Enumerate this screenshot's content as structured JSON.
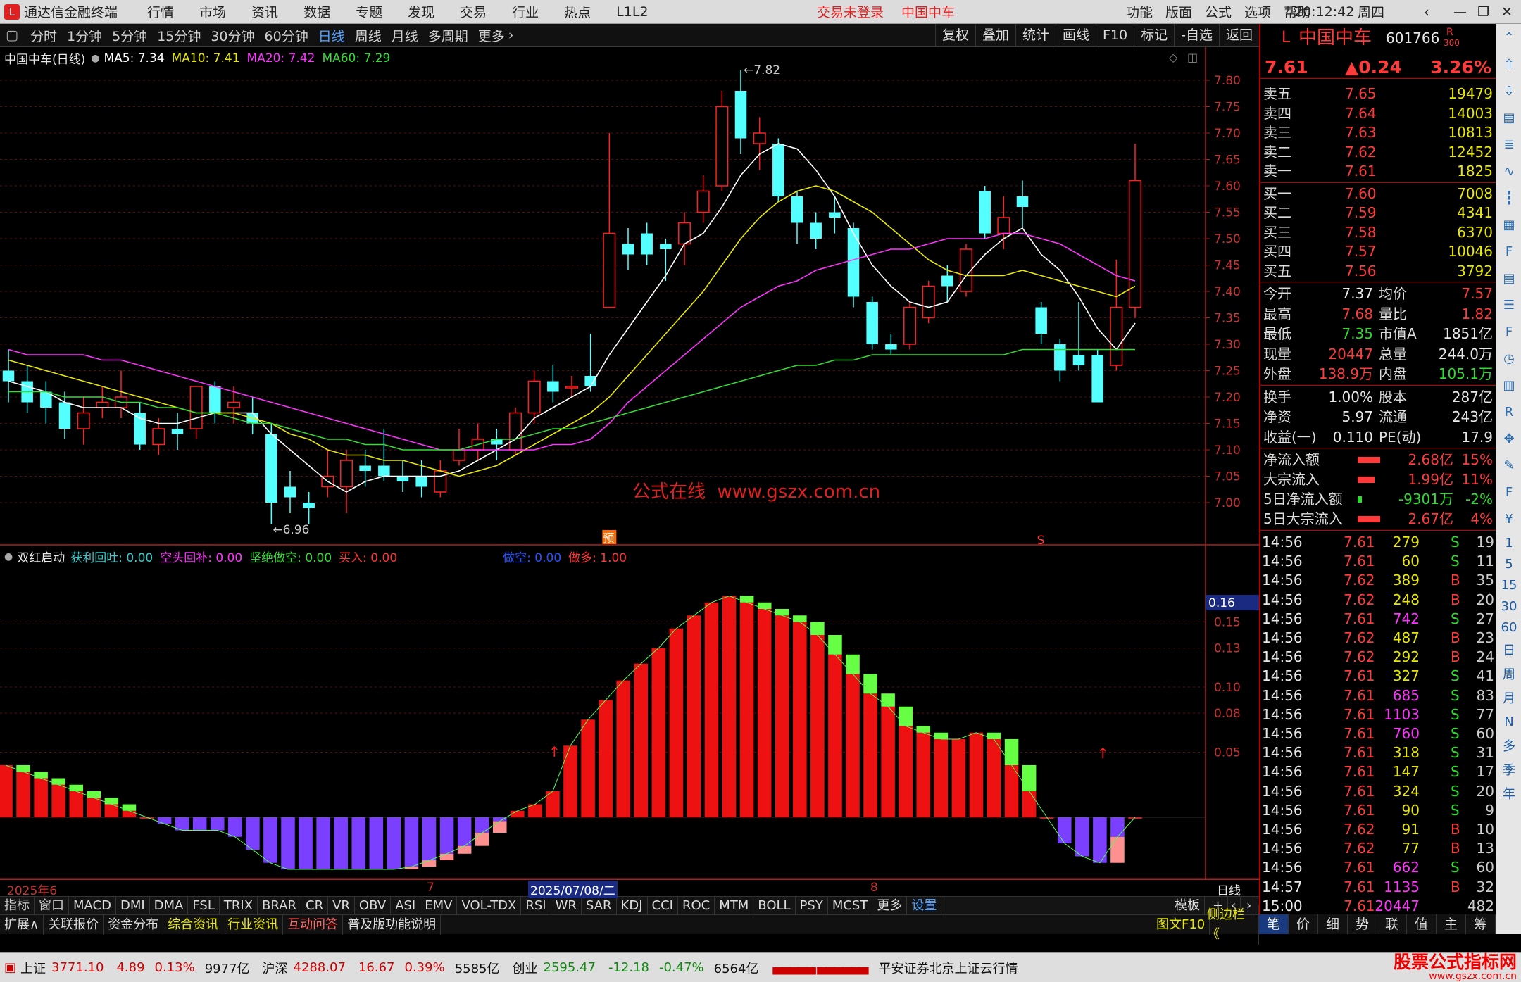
{
  "titlebar": {
    "app_name": "通达信金融终端",
    "menus": [
      "行情",
      "市场",
      "资讯",
      "数据",
      "专题",
      "发现",
      "交易",
      "行业",
      "热点",
      "L1L2"
    ],
    "trade_status": "交易未登录",
    "stock_name": "中国中车",
    "right_menus": [
      "功能",
      "版面",
      "公式",
      "选项",
      "帮助"
    ],
    "time": "20:12:42",
    "weekday": "周四"
  },
  "periodbar": {
    "periods": [
      "分时",
      "1分钟",
      "5分钟",
      "15分钟",
      "30分钟",
      "60分钟",
      "日线",
      "周线",
      "月线",
      "多周期",
      "更多"
    ],
    "active_index": 6,
    "tools": [
      "复权",
      "叠加",
      "统计",
      "画线",
      "F10",
      "标记",
      "-自选",
      "返回"
    ]
  },
  "main_chart": {
    "title": "中国中车(日线)",
    "ma_labels": [
      {
        "text": "MA5: 7.34",
        "color": "#ffffff"
      },
      {
        "text": "MA10: 7.41",
        "color": "#e8e800"
      },
      {
        "text": "MA20: 7.42",
        "color": "#ff33ff"
      },
      {
        "text": "MA60: 7.29",
        "color": "#33dd33"
      }
    ],
    "price_ticks": [
      "7.80",
      "7.75",
      "7.70",
      "7.65",
      "7.60",
      "7.55",
      "7.50",
      "7.45",
      "7.40",
      "7.35",
      "7.30",
      "7.25",
      "7.20",
      "7.15",
      "7.10",
      "7.05",
      "7.00"
    ],
    "high_label": "7.82",
    "low_label": "6.96",
    "watermark": "公式在线  www.gszx.com.cn",
    "marker_yu": "预",
    "marker_s": "S",
    "candles": [
      {
        "o": 7.25,
        "c": 7.23,
        "h": 7.29,
        "l": 7.19
      },
      {
        "o": 7.23,
        "c": 7.19,
        "h": 7.26,
        "l": 7.17
      },
      {
        "o": 7.21,
        "c": 7.18,
        "h": 7.23,
        "l": 7.15
      },
      {
        "o": 7.19,
        "c": 7.14,
        "h": 7.21,
        "l": 7.12
      },
      {
        "o": 7.14,
        "c": 7.17,
        "h": 7.2,
        "l": 7.11
      },
      {
        "o": 7.18,
        "c": 7.19,
        "h": 7.22,
        "l": 7.16
      },
      {
        "o": 7.18,
        "c": 7.2,
        "h": 7.25,
        "l": 7.16
      },
      {
        "o": 7.17,
        "c": 7.11,
        "h": 7.19,
        "l": 7.1
      },
      {
        "o": 7.11,
        "c": 7.14,
        "h": 7.16,
        "l": 7.09
      },
      {
        "o": 7.14,
        "c": 7.13,
        "h": 7.17,
        "l": 7.1
      },
      {
        "o": 7.14,
        "c": 7.22,
        "h": 7.22,
        "l": 7.12
      },
      {
        "o": 7.22,
        "c": 7.17,
        "h": 7.23,
        "l": 7.15
      },
      {
        "o": 7.18,
        "c": 7.19,
        "h": 7.22,
        "l": 7.15
      },
      {
        "o": 7.17,
        "c": 7.15,
        "h": 7.2,
        "l": 7.13
      },
      {
        "o": 7.13,
        "c": 7.0,
        "h": 7.15,
        "l": 6.96
      },
      {
        "o": 7.03,
        "c": 7.01,
        "h": 7.06,
        "l": 6.98
      },
      {
        "o": 7.0,
        "c": 6.99,
        "h": 7.02,
        "l": 6.96
      },
      {
        "o": 7.03,
        "c": 7.05,
        "h": 7.1,
        "l": 7.01
      },
      {
        "o": 7.03,
        "c": 7.08,
        "h": 7.1,
        "l": 6.98
      },
      {
        "o": 7.07,
        "c": 7.06,
        "h": 7.1,
        "l": 7.03
      },
      {
        "o": 7.07,
        "c": 7.05,
        "h": 7.14,
        "l": 7.04
      },
      {
        "o": 7.05,
        "c": 7.04,
        "h": 7.08,
        "l": 7.02
      },
      {
        "o": 7.05,
        "c": 7.03,
        "h": 7.08,
        "l": 7.01
      },
      {
        "o": 7.02,
        "c": 7.06,
        "h": 7.08,
        "l": 7.01
      },
      {
        "o": 7.08,
        "c": 7.1,
        "h": 7.14,
        "l": 7.07
      },
      {
        "o": 7.1,
        "c": 7.12,
        "h": 7.15,
        "l": 7.08
      },
      {
        "o": 7.12,
        "c": 7.11,
        "h": 7.14,
        "l": 7.08
      },
      {
        "o": 7.1,
        "c": 7.17,
        "h": 7.18,
        "l": 7.09
      },
      {
        "o": 7.17,
        "c": 7.23,
        "h": 7.25,
        "l": 7.15
      },
      {
        "o": 7.23,
        "c": 7.21,
        "h": 7.26,
        "l": 7.19
      },
      {
        "o": 7.22,
        "c": 7.22,
        "h": 7.24,
        "l": 7.2
      },
      {
        "o": 7.24,
        "c": 7.22,
        "h": 7.32,
        "l": 7.21
      },
      {
        "o": 7.37,
        "c": 7.51,
        "h": 7.7,
        "l": 7.37
      },
      {
        "o": 7.49,
        "c": 7.47,
        "h": 7.52,
        "l": 7.44
      },
      {
        "o": 7.51,
        "c": 7.47,
        "h": 7.53,
        "l": 7.45
      },
      {
        "o": 7.49,
        "c": 7.48,
        "h": 7.5,
        "l": 7.42
      },
      {
        "o": 7.49,
        "c": 7.53,
        "h": 7.55,
        "l": 7.45
      },
      {
        "o": 7.55,
        "c": 7.59,
        "h": 7.62,
        "l": 7.53
      },
      {
        "o": 7.6,
        "c": 7.75,
        "h": 7.78,
        "l": 7.59
      },
      {
        "o": 7.78,
        "c": 7.69,
        "h": 7.82,
        "l": 7.66
      },
      {
        "o": 7.68,
        "c": 7.7,
        "h": 7.73,
        "l": 7.63
      },
      {
        "o": 7.68,
        "c": 7.58,
        "h": 7.69,
        "l": 7.57
      },
      {
        "o": 7.58,
        "c": 7.53,
        "h": 7.59,
        "l": 7.49
      },
      {
        "o": 7.53,
        "c": 7.5,
        "h": 7.55,
        "l": 7.48
      },
      {
        "o": 7.55,
        "c": 7.54,
        "h": 7.58,
        "l": 7.51
      },
      {
        "o": 7.52,
        "c": 7.39,
        "h": 7.53,
        "l": 7.37
      },
      {
        "o": 7.38,
        "c": 7.3,
        "h": 7.39,
        "l": 7.29
      },
      {
        "o": 7.3,
        "c": 7.29,
        "h": 7.32,
        "l": 7.28
      },
      {
        "o": 7.3,
        "c": 7.37,
        "h": 7.38,
        "l": 7.29
      },
      {
        "o": 7.35,
        "c": 7.41,
        "h": 7.42,
        "l": 7.34
      },
      {
        "o": 7.43,
        "c": 7.41,
        "h": 7.45,
        "l": 7.38
      },
      {
        "o": 7.4,
        "c": 7.48,
        "h": 7.49,
        "l": 7.39
      },
      {
        "o": 7.59,
        "c": 7.51,
        "h": 7.6,
        "l": 7.5
      },
      {
        "o": 7.51,
        "c": 7.54,
        "h": 7.58,
        "l": 7.48
      },
      {
        "o": 7.58,
        "c": 7.56,
        "h": 7.61,
        "l": 7.52
      },
      {
        "o": 7.37,
        "c": 7.32,
        "h": 7.38,
        "l": 7.3
      },
      {
        "o": 7.3,
        "c": 7.25,
        "h": 7.31,
        "l": 7.23
      },
      {
        "o": 7.28,
        "c": 7.26,
        "h": 7.38,
        "l": 7.25
      },
      {
        "o": 7.28,
        "c": 7.19,
        "h": 7.29,
        "l": 7.19
      },
      {
        "o": 7.26,
        "c": 7.37,
        "h": 7.46,
        "l": 7.25
      },
      {
        "o": 7.37,
        "c": 7.61,
        "h": 7.68,
        "l": 7.35
      }
    ],
    "ma5": [
      7.23,
      7.22,
      7.21,
      7.19,
      7.18,
      7.18,
      7.18,
      7.16,
      7.15,
      7.15,
      7.16,
      7.17,
      7.17,
      7.17,
      7.13,
      7.1,
      7.07,
      7.04,
      7.02,
      7.04,
      7.05,
      7.05,
      7.05,
      7.05,
      7.06,
      7.08,
      7.1,
      7.12,
      7.16,
      7.18,
      7.2,
      7.22,
      7.28,
      7.33,
      7.38,
      7.43,
      7.49,
      7.51,
      7.56,
      7.62,
      7.66,
      7.68,
      7.67,
      7.63,
      7.58,
      7.51,
      7.45,
      7.41,
      7.38,
      7.37,
      7.38,
      7.43,
      7.47,
      7.5,
      7.52,
      7.47,
      7.44,
      7.39,
      7.33,
      7.29,
      7.34
    ],
    "ma10": [
      7.27,
      7.26,
      7.25,
      7.24,
      7.23,
      7.22,
      7.21,
      7.2,
      7.19,
      7.18,
      7.17,
      7.17,
      7.17,
      7.16,
      7.15,
      7.13,
      7.12,
      7.1,
      7.09,
      7.09,
      7.08,
      7.08,
      7.07,
      7.06,
      7.05,
      7.06,
      7.07,
      7.09,
      7.11,
      7.13,
      7.15,
      7.17,
      7.2,
      7.24,
      7.28,
      7.32,
      7.36,
      7.4,
      7.45,
      7.5,
      7.54,
      7.57,
      7.59,
      7.6,
      7.59,
      7.57,
      7.55,
      7.52,
      7.49,
      7.46,
      7.44,
      7.43,
      7.43,
      7.43,
      7.44,
      7.43,
      7.42,
      7.41,
      7.4,
      7.39,
      7.41
    ],
    "ma20": [
      7.29,
      7.28,
      7.28,
      7.28,
      7.28,
      7.27,
      7.27,
      7.26,
      7.25,
      7.24,
      7.23,
      7.22,
      7.21,
      7.2,
      7.19,
      7.18,
      7.17,
      7.16,
      7.15,
      7.14,
      7.13,
      7.12,
      7.11,
      7.1,
      7.1,
      7.1,
      7.1,
      7.1,
      7.1,
      7.11,
      7.11,
      7.12,
      7.15,
      7.19,
      7.22,
      7.25,
      7.28,
      7.31,
      7.34,
      7.37,
      7.39,
      7.41,
      7.42,
      7.44,
      7.45,
      7.46,
      7.47,
      7.48,
      7.48,
      7.49,
      7.5,
      7.5,
      7.5,
      7.51,
      7.51,
      7.5,
      7.49,
      7.47,
      7.45,
      7.43,
      7.42
    ],
    "ma60": [
      7.21,
      7.21,
      7.21,
      7.2,
      7.2,
      7.2,
      7.19,
      7.19,
      7.18,
      7.18,
      7.17,
      7.17,
      7.16,
      7.15,
      7.15,
      7.14,
      7.13,
      7.12,
      7.12,
      7.11,
      7.11,
      7.1,
      7.1,
      7.1,
      7.1,
      7.11,
      7.12,
      7.12,
      7.13,
      7.14,
      7.14,
      7.15,
      7.16,
      7.17,
      7.18,
      7.19,
      7.2,
      7.21,
      7.22,
      7.23,
      7.24,
      7.25,
      7.26,
      7.26,
      7.27,
      7.27,
      7.28,
      7.28,
      7.28,
      7.28,
      7.28,
      7.28,
      7.28,
      7.28,
      7.29,
      7.29,
      7.29,
      7.29,
      7.29,
      7.29,
      7.29
    ]
  },
  "indicator": {
    "name": "双红启动",
    "params": [
      {
        "text": "获利回吐: 0.00",
        "color": "#33cccc"
      },
      {
        "text": "空头回补: 0.00",
        "color": "#ff33ff"
      },
      {
        "text": "坚绝做空: 0.00",
        "color": "#33dd33"
      },
      {
        "text": "买入: 0.00",
        "color": "#ff3333"
      },
      {
        "text": "做空: 0.00",
        "color": "#2255ff"
      },
      {
        "text": "做多: 1.00",
        "color": "#ff3333"
      }
    ],
    "ticks": [
      "0.15",
      "0.13",
      "0.10",
      "0.08",
      "0.05"
    ],
    "current_value": "0.16",
    "values": [
      0.04,
      0.035,
      0.03,
      0.025,
      0.02,
      0.015,
      0.01,
      0.005,
      0.0,
      -0.005,
      -0.01,
      -0.01,
      -0.01,
      -0.015,
      -0.025,
      -0.035,
      -0.04,
      -0.04,
      -0.04,
      -0.04,
      -0.04,
      -0.04,
      -0.04,
      -0.038,
      -0.033,
      -0.028,
      -0.022,
      -0.012,
      -0.003,
      0.005,
      0.01,
      0.02,
      0.055,
      0.075,
      0.09,
      0.105,
      0.118,
      0.13,
      0.145,
      0.155,
      0.165,
      0.17,
      0.165,
      0.16,
      0.155,
      0.15,
      0.14,
      0.125,
      0.11,
      0.095,
      0.085,
      0.07,
      0.065,
      0.06,
      0.06,
      0.065,
      0.06,
      0.04,
      0.02,
      0.0,
      -0.02,
      -0.03,
      -0.035,
      -0.015,
      0.0
    ],
    "x_labels": [
      "2025年6",
      "7",
      "2025/07/08/二",
      "8"
    ],
    "period_label": "日线"
  },
  "indicator_tabs": [
    "指标",
    "窗口",
    "MACD",
    "DMI",
    "DMA",
    "FSL",
    "TRIX",
    "BRAR",
    "CR",
    "VR",
    "OBV",
    "ASI",
    "EMV",
    "VOL-TDX",
    "RSI",
    "WR",
    "SAR",
    "KDJ",
    "CCI",
    "ROC",
    "MTM",
    "BOLL",
    "PSY",
    "MCST",
    "更多",
    "设置"
  ],
  "indicator_tabs_right": "模板",
  "info_tabs": [
    {
      "text": "扩展∧",
      "color": "#dddddd"
    },
    {
      "text": "关联报价",
      "color": "#dddddd"
    },
    {
      "text": "资金分布",
      "color": "#dddddd"
    },
    {
      "text": "综合资讯",
      "color": "#e8e800"
    },
    {
      "text": "行业资讯",
      "color": "#e8e800"
    },
    {
      "text": "互动问答",
      "color": "#ff6666"
    },
    {
      "text": "普及版功能说明",
      "color": "#dddddd"
    }
  ],
  "info_right": [
    "图文F10",
    "侧边栏《"
  ],
  "quote": {
    "prefix": "L",
    "name": "中国中车",
    "code": "601766",
    "flag": "R",
    "flag_sub": "300",
    "price": "7.61",
    "change": "▲0.24",
    "pct": "3.26%",
    "asks": [
      {
        "label": "卖五",
        "price": "7.65",
        "vol": "19479"
      },
      {
        "label": "卖四",
        "price": "7.64",
        "vol": "14003"
      },
      {
        "label": "卖三",
        "price": "7.63",
        "vol": "10813"
      },
      {
        "label": "卖二",
        "price": "7.62",
        "vol": "12452"
      },
      {
        "label": "卖一",
        "price": "7.61",
        "vol": "1825"
      }
    ],
    "bids": [
      {
        "label": "买一",
        "price": "7.60",
        "vol": "7008"
      },
      {
        "label": "买二",
        "price": "7.59",
        "vol": "4341"
      },
      {
        "label": "买三",
        "price": "7.58",
        "vol": "6370"
      },
      {
        "label": "买四",
        "price": "7.57",
        "vol": "10046"
      },
      {
        "label": "买五",
        "price": "7.56",
        "vol": "3792"
      }
    ],
    "stats": [
      {
        "l1": "今开",
        "v1": "7.37",
        "c1": "#e8e8e8",
        "l2": "均价",
        "v2": "7.57",
        "c2": "#ff3a3a"
      },
      {
        "l1": "最高",
        "v1": "7.68",
        "c1": "#ff3a3a",
        "l2": "量比",
        "v2": "1.82",
        "c2": "#ff3a3a"
      },
      {
        "l1": "最低",
        "v1": "7.35",
        "c1": "#2ddc2d",
        "l2": "市值A",
        "v2": "1851亿",
        "c2": "#e8e8e8"
      },
      {
        "l1": "现量",
        "v1": "20447",
        "c1": "#ff3a3a",
        "l2": "总量",
        "v2": "244.0万",
        "c2": "#e8e8e8"
      },
      {
        "l1": "外盘",
        "v1": "138.9万",
        "c1": "#ff3a3a",
        "l2": "内盘",
        "v2": "105.1万",
        "c2": "#2ddc2d"
      },
      {
        "l1": "换手",
        "v1": "1.00%",
        "c1": "#e8e8e8",
        "l2": "股本",
        "v2": "287亿",
        "c2": "#e8e8e8"
      },
      {
        "l1": "净资",
        "v1": "5.97",
        "c1": "#e8e8e8",
        "l2": "流通",
        "v2": "243亿",
        "c2": "#e8e8e8"
      },
      {
        "l1": "收益(一)",
        "v1": "0.110",
        "c1": "#e8e8e8",
        "l2": "PE(动)",
        "v2": "17.9",
        "c2": "#e8e8e8"
      }
    ],
    "flows": [
      {
        "label": "净流入额",
        "value": "2.68亿",
        "pct": "15%",
        "bar": 0.8,
        "color": "#ff3a3a"
      },
      {
        "label": "大宗流入",
        "value": "1.99亿",
        "pct": "11%",
        "bar": 0.6,
        "color": "#ff3a3a"
      },
      {
        "label": "5日净流入额",
        "value": "-9301万",
        "pct": "-2%",
        "bar": 0.15,
        "color": "#2ddc2d"
      },
      {
        "label": "5日大宗流入",
        "value": "2.67亿",
        "pct": "4%",
        "bar": 0.8,
        "color": "#ff3a3a"
      }
    ],
    "ticks": [
      {
        "t": "14:56",
        "p": "7.61",
        "v": "279",
        "s": "S",
        "n": "19"
      },
      {
        "t": "14:56",
        "p": "7.61",
        "v": "60",
        "s": "S",
        "n": "11"
      },
      {
        "t": "14:56",
        "p": "7.62",
        "v": "389",
        "s": "B",
        "n": "35"
      },
      {
        "t": "14:56",
        "p": "7.62",
        "v": "248",
        "s": "B",
        "n": "20"
      },
      {
        "t": "14:56",
        "p": "7.61",
        "v": "742",
        "s": "S",
        "n": "27"
      },
      {
        "t": "14:56",
        "p": "7.62",
        "v": "487",
        "s": "B",
        "n": "23"
      },
      {
        "t": "14:56",
        "p": "7.62",
        "v": "292",
        "s": "B",
        "n": "24"
      },
      {
        "t": "14:56",
        "p": "7.61",
        "v": "327",
        "s": "S",
        "n": "41"
      },
      {
        "t": "14:56",
        "p": "7.61",
        "v": "685",
        "s": "S",
        "n": "83"
      },
      {
        "t": "14:56",
        "p": "7.61",
        "v": "1103",
        "s": "S",
        "n": "77"
      },
      {
        "t": "14:56",
        "p": "7.61",
        "v": "760",
        "s": "S",
        "n": "60"
      },
      {
        "t": "14:56",
        "p": "7.61",
        "v": "318",
        "s": "S",
        "n": "31"
      },
      {
        "t": "14:56",
        "p": "7.61",
        "v": "147",
        "s": "S",
        "n": "17"
      },
      {
        "t": "14:56",
        "p": "7.61",
        "v": "324",
        "s": "S",
        "n": "20"
      },
      {
        "t": "14:56",
        "p": "7.61",
        "v": "90",
        "s": "S",
        "n": "9"
      },
      {
        "t": "14:56",
        "p": "7.62",
        "v": "91",
        "s": "B",
        "n": "10"
      },
      {
        "t": "14:56",
        "p": "7.62",
        "v": "77",
        "s": "B",
        "n": "13"
      },
      {
        "t": "14:56",
        "p": "7.61",
        "v": "662",
        "s": "S",
        "n": "60"
      },
      {
        "t": "14:57",
        "p": "7.61",
        "v": "1135",
        "s": "B",
        "n": "32"
      },
      {
        "t": "15:00",
        "p": "7.61",
        "v": "20447",
        "s": "",
        "n": "482"
      }
    ]
  },
  "quote_tabs": [
    "笔",
    "价",
    "细",
    "势",
    "联",
    "值",
    "主",
    "筹"
  ],
  "sidebar_chars": [
    "日",
    "周",
    "月",
    "N",
    "多",
    "季",
    "年"
  ],
  "sidebar_nums": [
    "1",
    "5",
    "15",
    "30",
    "60"
  ],
  "status": {
    "indices": [
      {
        "name": "上证",
        "value": "3771.10",
        "chg": "4.89",
        "pct": "0.13%",
        "amt": "9977亿"
      },
      {
        "name": "沪深",
        "value": "4288.07",
        "chg": "16.67",
        "pct": "0.39%",
        "amt": "5585亿"
      },
      {
        "name": "创业",
        "value": "2595.47",
        "chg": "-12.18",
        "pct": "-0.47%",
        "amt": "6564亿"
      }
    ],
    "broker": "平安证券北京上证云行情",
    "logo_text": "股票公式指标网",
    "logo_url": "www.gszx.com.cn"
  }
}
